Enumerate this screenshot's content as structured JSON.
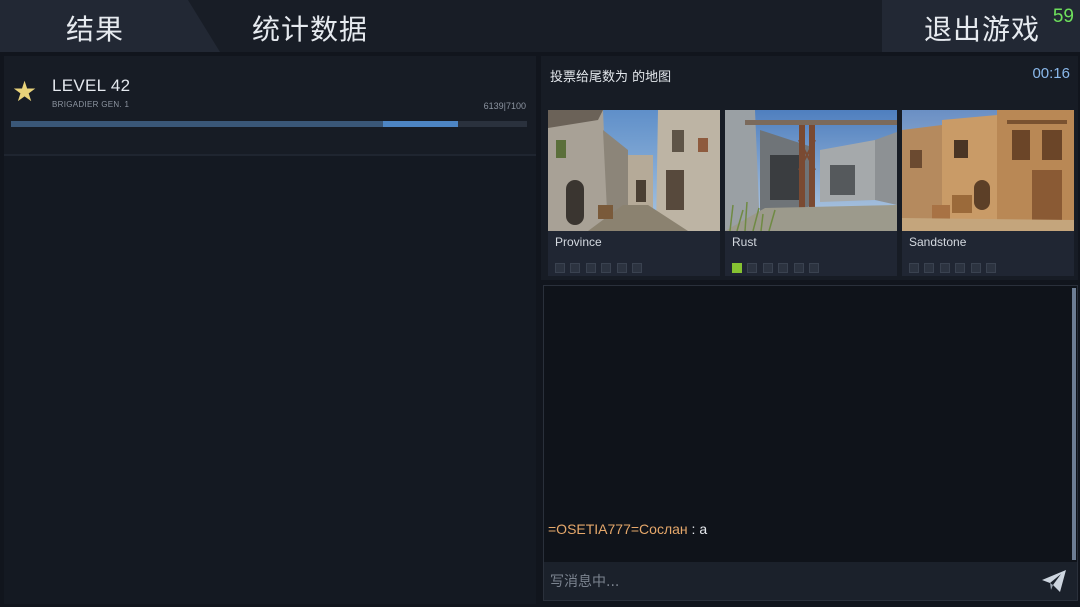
{
  "tabs": {
    "results": "结果",
    "stats": "统计数据"
  },
  "exit": {
    "label": "退出游戏",
    "countdown": "59"
  },
  "level": {
    "title": "LEVEL 42",
    "rank": "BRIGADIER GEN. 1",
    "xp_text": "6139|7100",
    "xp_previous_fraction": 0.72,
    "xp_current_fraction": 0.865
  },
  "vote": {
    "title": "投票给尾数为 的地图",
    "timer": "00:16",
    "maps": [
      {
        "name": "Province",
        "votes": [
          false,
          false,
          false,
          false,
          false,
          false
        ]
      },
      {
        "name": "Rust",
        "votes": [
          true,
          false,
          false,
          false,
          false,
          false
        ]
      },
      {
        "name": "Sandstone",
        "votes": [
          false,
          false,
          false,
          false,
          false,
          false
        ]
      }
    ]
  },
  "chat": {
    "messages": [
      {
        "sender": "=OSETIA777=Сослан",
        "separator": " : ",
        "text": "a"
      }
    ],
    "placeholder": "写消息中..."
  },
  "colors": {
    "accent": "#4d85c4",
    "countdown": "#6ee05c",
    "sender": "#e6a86b",
    "vote_on": "#86c232"
  }
}
